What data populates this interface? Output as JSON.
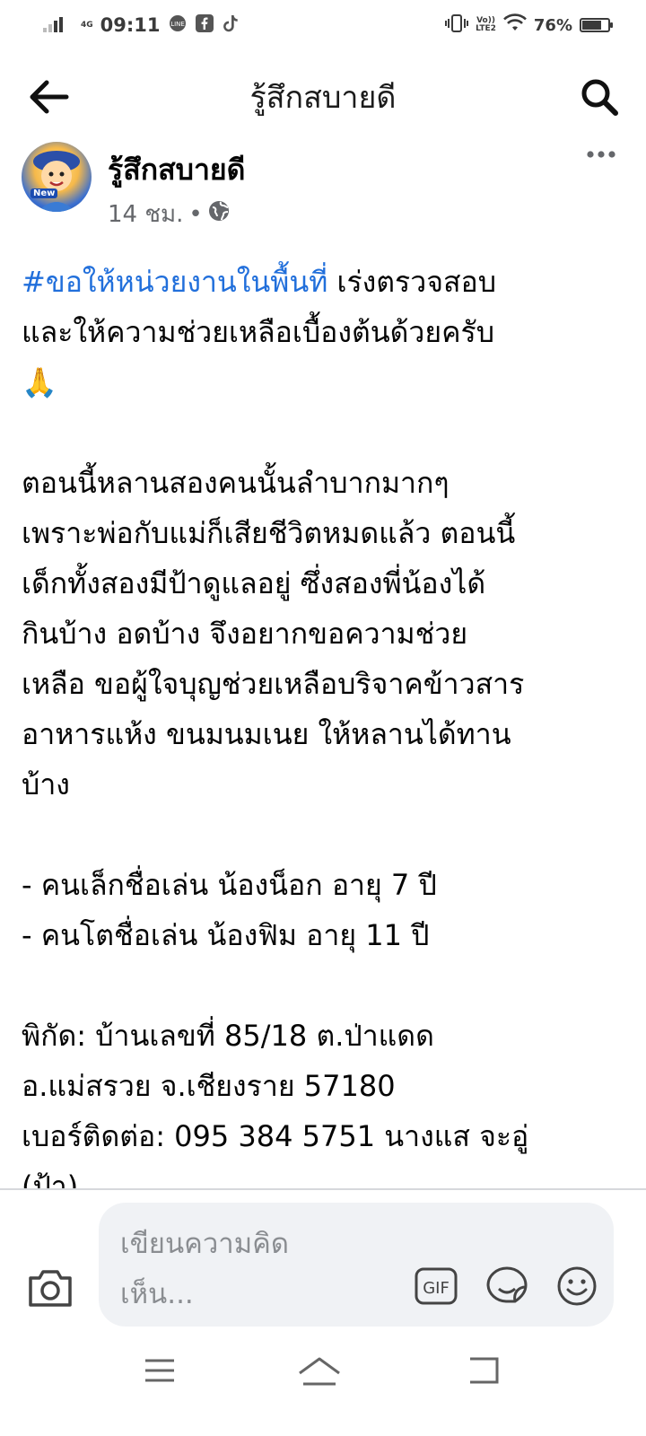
{
  "status_bar": {
    "network": "4G",
    "time": "09:11",
    "volte": "Vo))",
    "lte": "LTE2",
    "battery_percent": "76%",
    "battery_level": 0.76
  },
  "topbar": {
    "title": "รู้สึกสบายดี"
  },
  "post": {
    "author": "รู้สึกสบายดี",
    "avatar_text": "New",
    "time": "14 ชม.",
    "separator": "•",
    "hashtag": "#ขอให้หน่วยงานในพื้นที่",
    "line1_rest": " เร่งตรวจสอบ",
    "line2": "และให้ความช่วยเหลือเบื้องต้นด้วยครับ",
    "emoji": "🙏",
    "para2_lines": [
      "ตอนนี้หลานสองคนนั้นลำบากมากๆ",
      "เพราะพ่อกับแม่ก็เสียชีวิตหมดแล้ว ตอนนี้",
      "เด็กทั้งสองมีป้าดูแลอยู่ ซึ่งสองพี่น้องได้",
      "กินบ้าง อดบ้าง  จึงอยากขอความช่วย",
      "เหลือ ขอผู้ใจบุญช่วยเหลือบริจาคข้าวสาร",
      "อาหารแห้ง ขนมนมเนย ให้หลานได้ทาน",
      "บ้าง"
    ],
    "children_lines": [
      "- คนเล็กชื่อเล่น น้องน็อก อายุ 7 ปี",
      "- คนโตชื่อเล่น น้องฟิม อายุ 11 ปี"
    ],
    "contact_lines": [
      "พิกัด: บ้านเลขที่ 85/18 ต.ป่าแดด",
      "อ.แม่สรวย จ.เชียงราย 57180",
      "เบอร์ติดต่อ: 095 384 5751 นางแส จะอู่",
      "(ป้า)"
    ]
  },
  "composer": {
    "placeholder": "เขียนความคิดเห็น...",
    "placeholder_line1": "เขียนความคิด",
    "placeholder_line2": "เห็น...",
    "gif_label": "GIF"
  },
  "icons": {
    "back": "back-arrow-icon",
    "search": "search-icon",
    "more": "more-dots-icon",
    "globe": "globe-icon",
    "camera": "camera-icon",
    "gif": "gif-icon",
    "sticker": "sticker-icon",
    "emoji": "emoji-icon"
  },
  "colors": {
    "hashtag": "#216fdb",
    "meta_text": "#65676b",
    "comment_bg": "#f0f2f5"
  }
}
